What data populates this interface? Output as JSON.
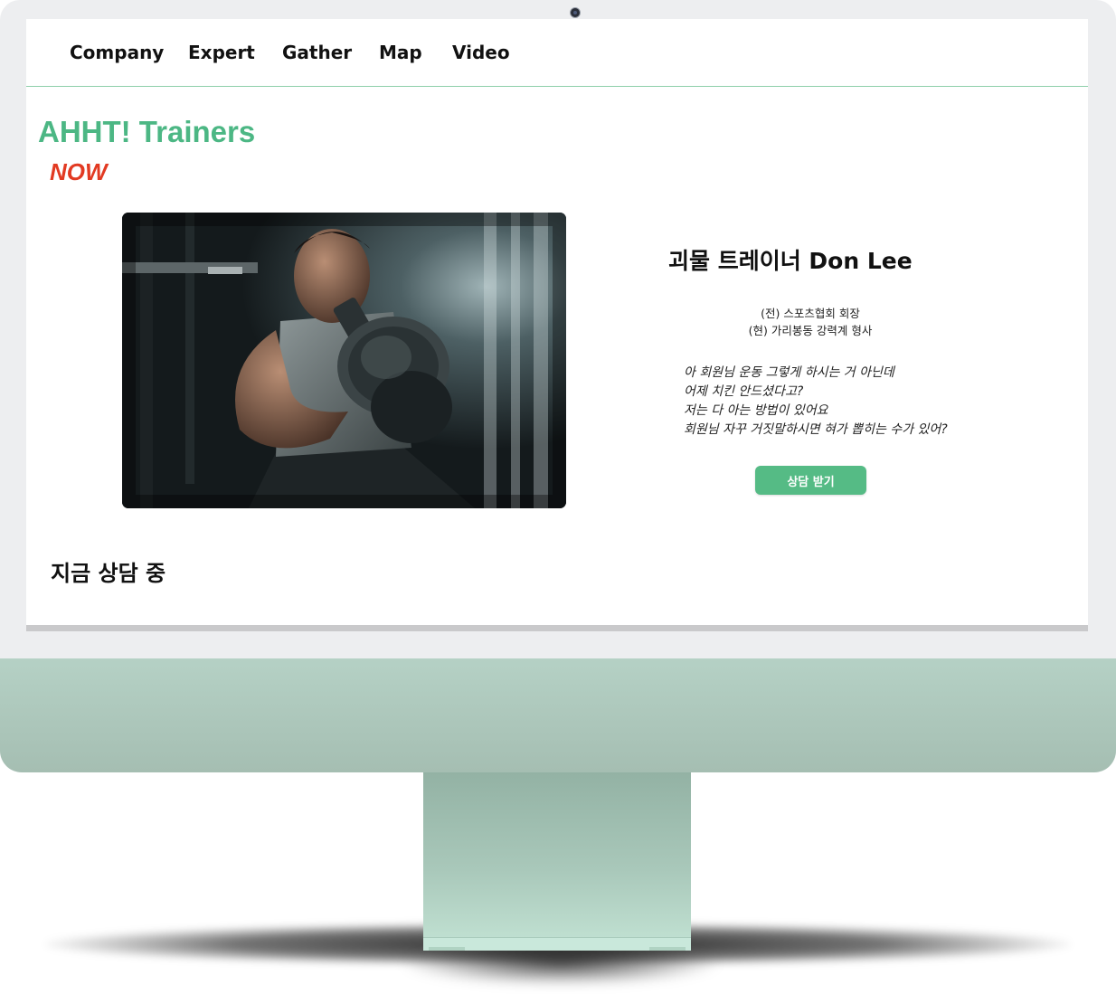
{
  "nav": {
    "items": [
      {
        "label": "Company"
      },
      {
        "label": "Expert"
      },
      {
        "label": "Gather"
      },
      {
        "label": "Map"
      },
      {
        "label": "Video"
      }
    ]
  },
  "brand": {
    "title": "AHHT! Trainers",
    "subtitle": "NOW"
  },
  "trainer": {
    "name": "괴물 트레이너 Don Lee",
    "career": [
      "(전) 스포츠협회 회장",
      "(현) 가리봉동 강력계 형사"
    ],
    "quote": [
      "아 회원님 운동 그렇게 하시는 거 아닌데",
      "어제 치킨 안드셨다고?",
      "저는 다 아는 방법이 있어요",
      "회원님 자꾸 거짓말하시면 혀가 뽑히는 수가 있어?"
    ],
    "consult_button": "상담 받기"
  },
  "section": {
    "title": "지금 상담 중"
  },
  "colors": {
    "brand": "#4cb784",
    "now": "#e23a22",
    "button": "#55bb85",
    "monitor_chin": "#b5d1c5"
  }
}
